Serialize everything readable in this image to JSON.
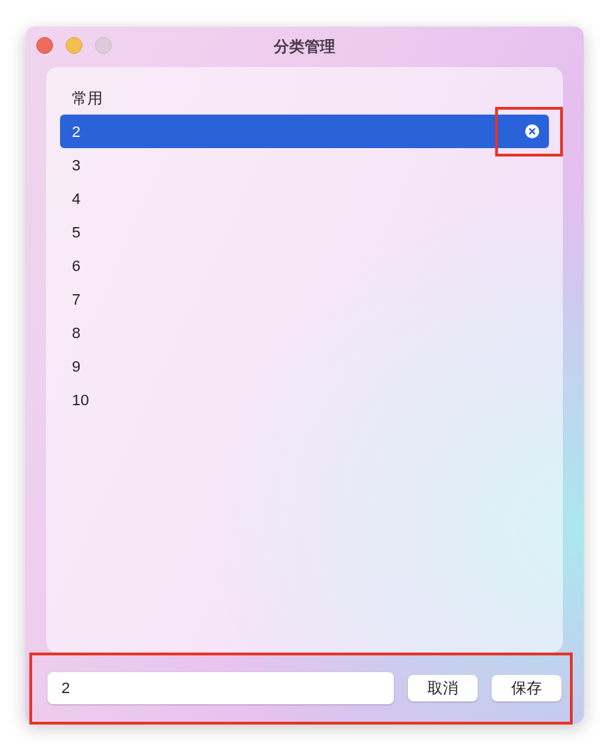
{
  "window": {
    "title": "分类管理",
    "traffic_lights": [
      {
        "kind": "close",
        "disabled": false
      },
      {
        "kind": "minimize",
        "disabled": false
      },
      {
        "kind": "zoom",
        "disabled": true
      }
    ]
  },
  "categories": [
    {
      "label": "常用",
      "selected": false
    },
    {
      "label": "2",
      "selected": true
    },
    {
      "label": "3",
      "selected": false
    },
    {
      "label": "4",
      "selected": false
    },
    {
      "label": "5",
      "selected": false
    },
    {
      "label": "6",
      "selected": false
    },
    {
      "label": "7",
      "selected": false
    },
    {
      "label": "8",
      "selected": false
    },
    {
      "label": "9",
      "selected": false
    },
    {
      "label": "10",
      "selected": false
    }
  ],
  "editor": {
    "value": "2",
    "buttons": [
      "取消",
      "保存"
    ]
  },
  "annotation_frames": {
    "row_action": true,
    "editor": true
  }
}
